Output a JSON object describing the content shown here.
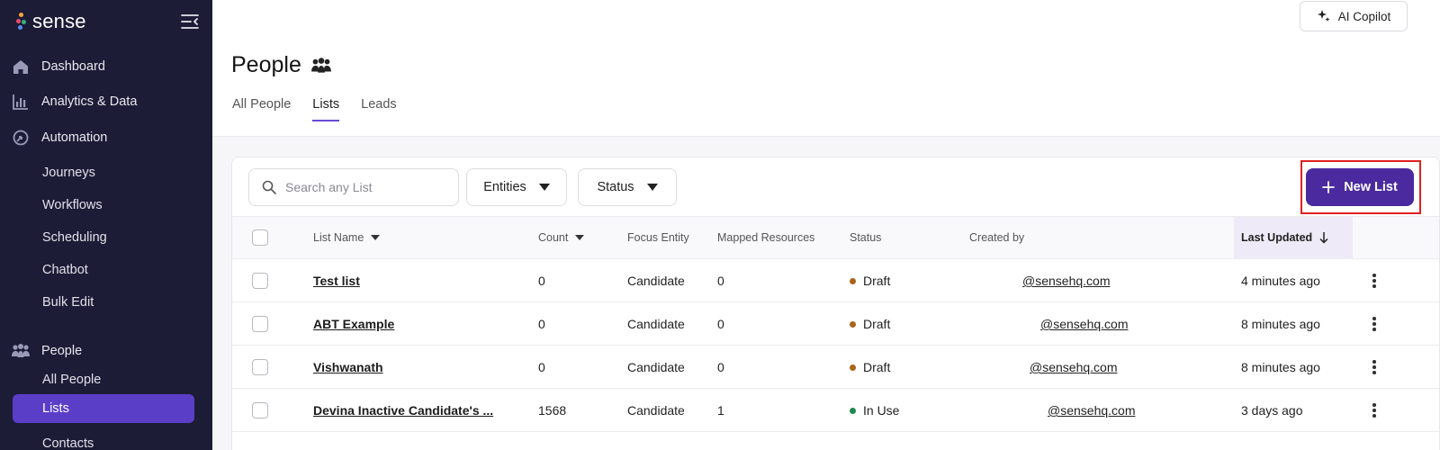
{
  "brand": {
    "name": "sense",
    "dot_colors": [
      "#f4a63b",
      "#e84b6a",
      "#35b27e",
      "#5b8def"
    ]
  },
  "sidebar": {
    "main": [
      {
        "label": "Dashboard",
        "icon": "home-icon"
      },
      {
        "label": "Analytics & Data",
        "icon": "bar-chart-icon"
      },
      {
        "label": "Automation",
        "icon": "automation-icon"
      }
    ],
    "automation_items": [
      "Journeys",
      "Workflows",
      "Scheduling",
      "Chatbot",
      "Bulk Edit"
    ],
    "people": {
      "label": "People",
      "icon": "people-icon"
    },
    "people_items": [
      "All People",
      "Lists",
      "Contacts"
    ]
  },
  "header": {
    "copilot_label": "AI Copilot",
    "title": "People",
    "tabs": [
      "All People",
      "Lists",
      "Leads"
    ],
    "active_tab": "Lists"
  },
  "toolbar": {
    "search_placeholder": "Search any List",
    "entities_label": "Entities",
    "status_label": "Status",
    "new_list_label": "New List"
  },
  "table": {
    "columns": [
      "List Name",
      "Count",
      "Focus Entity",
      "Mapped Resources",
      "Status",
      "Created by",
      "Last Updated"
    ],
    "rows": [
      {
        "name": "Test list",
        "count": "0",
        "focus": "Candidate",
        "mapped": "0",
        "status": "Draft",
        "status_color": "#a8651b",
        "email": "@sensehq.com",
        "updated": "4 minutes ago"
      },
      {
        "name": "ABT Example",
        "count": "0",
        "focus": "Candidate",
        "mapped": "0",
        "status": "Draft",
        "status_color": "#a8651b",
        "email": "@sensehq.com",
        "updated": "8 minutes ago"
      },
      {
        "name": "Vishwanath",
        "count": "0",
        "focus": "Candidate",
        "mapped": "0",
        "status": "Draft",
        "status_color": "#a8651b",
        "email": "@sensehq.com",
        "updated": "8 minutes ago"
      },
      {
        "name": "Devina Inactive Candidate's ...",
        "count": "1568",
        "focus": "Candidate",
        "mapped": "1",
        "status": "In Use",
        "status_color": "#1e8a4c",
        "email": "@sensehq.com",
        "updated": "3 days ago"
      }
    ]
  },
  "colors": {
    "sidebar_bg": "#1d1c37",
    "accent": "#5b3ec8",
    "primary_button": "#4a2a9e",
    "highlight_box": "#e02020"
  }
}
